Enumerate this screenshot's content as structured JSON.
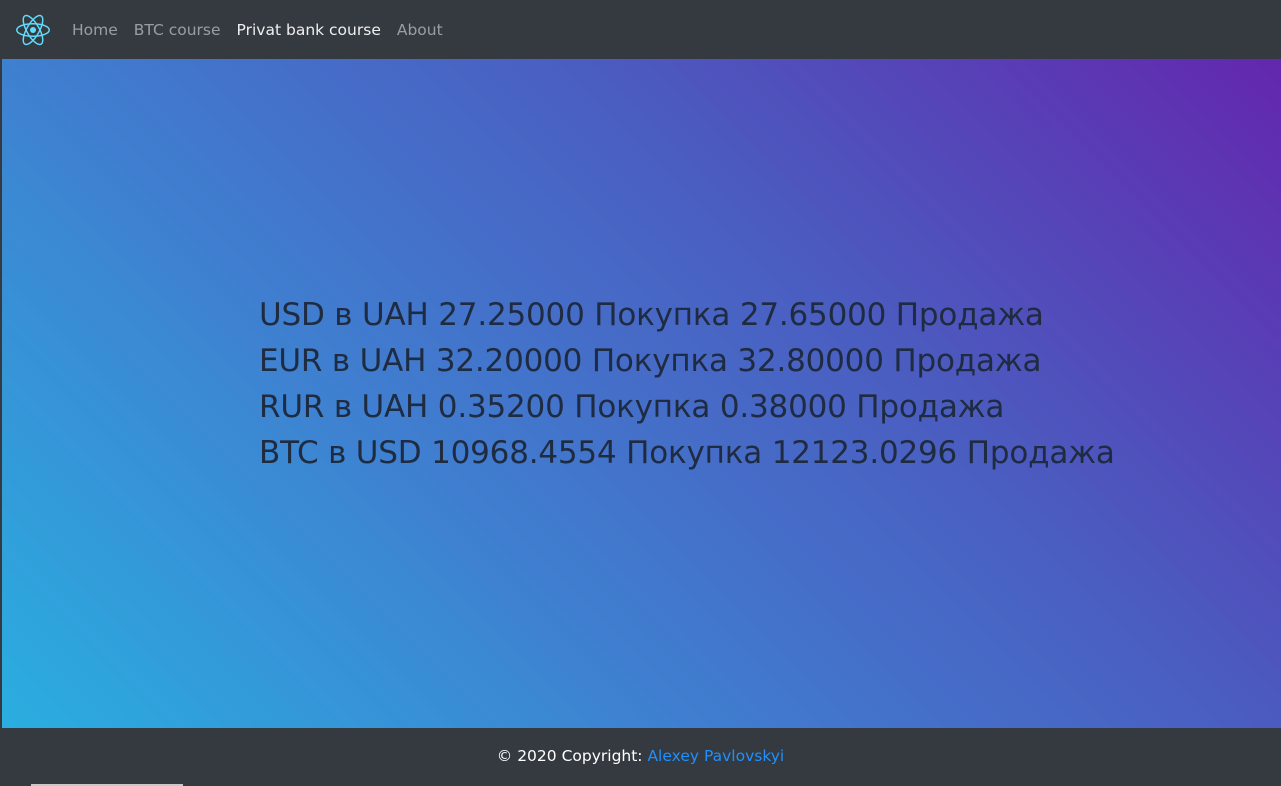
{
  "navbar": {
    "brand_icon": "react-logo-icon",
    "links": [
      {
        "label": "Home"
      },
      {
        "label": "BTC course"
      },
      {
        "label": "Privat bank course",
        "active": true
      },
      {
        "label": "About"
      }
    ]
  },
  "rates": [
    {
      "text": "USD в UAH 27.25000 Покупка 27.65000 Продажа"
    },
    {
      "text": "EUR в UAH 32.20000 Покупка 32.80000 Продажа"
    },
    {
      "text": "RUR в UAH 0.35200 Покупка 0.38000 Продажа"
    },
    {
      "text": "BTC в USD 10968.4554 Покупка 12123.0296 Продажа"
    }
  ],
  "footer": {
    "copyright": "© 2020 Copyright: ",
    "author": "Alexey Pavlovskyi"
  },
  "colors": {
    "navbar_bg": "#343a40",
    "gradient_start": "#2aaee0",
    "gradient_end": "#6327ae",
    "link_accent": "#1e90ff",
    "react_logo": "#61dafb"
  }
}
